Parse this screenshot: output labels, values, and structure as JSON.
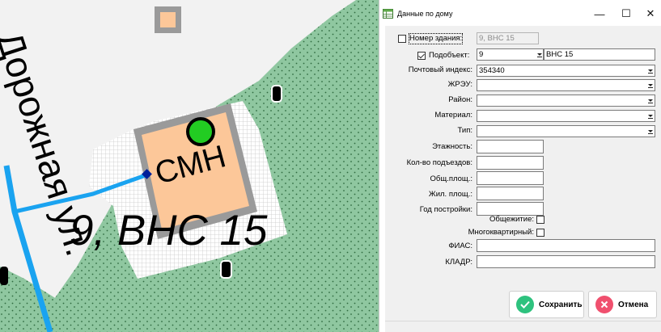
{
  "map": {
    "building_marker": "СМН",
    "address_label": "9, ВНС 15",
    "street_label": "Дорожная ул.",
    "colors": {
      "greenspace": "#8fc7a0",
      "building": "#fcc799",
      "road": "#1aa3f0",
      "hatch": "#cfcfcf",
      "marker_green": "#22cc22",
      "point": "#00209a"
    }
  },
  "dialog": {
    "title": "Данные по дому",
    "title_icon": "table-icon",
    "window_controls": {
      "minimize": "—",
      "maximize": "☐",
      "close": "✕"
    },
    "fields": {
      "building_number": {
        "label": "Номер здания:",
        "value": "9, ВНС 15",
        "checked": false
      },
      "subobject": {
        "label": "Подобъект:",
        "number": "9",
        "name": "ВНС 15",
        "checked": true
      },
      "postal_index": {
        "label": "Почтовый индекс:",
        "value": "354340"
      },
      "zhreu": {
        "label": "ЖРЭУ:",
        "value": ""
      },
      "district": {
        "label": "Район:",
        "value": ""
      },
      "material": {
        "label": "Материал:",
        "value": ""
      },
      "type": {
        "label": "Тип:",
        "value": ""
      },
      "floors": {
        "label": "Этажность:",
        "value": ""
      },
      "entrances": {
        "label": "Кол-во подъездов:",
        "value": ""
      },
      "total_area": {
        "label": "Общ.площ.:",
        "value": ""
      },
      "living_area": {
        "label": "Жил. площ.:",
        "value": ""
      },
      "year_built": {
        "label": "Год постройки:",
        "value": ""
      },
      "dormitory": {
        "label": "Общежитие:",
        "checked": false
      },
      "apartment_building": {
        "label": "Многоквартирный:",
        "checked": false
      },
      "fias": {
        "label": "ФИАС:",
        "value": ""
      },
      "kladr": {
        "label": "КЛАДР:",
        "value": ""
      }
    },
    "buttons": {
      "save": {
        "label": "Сохранить",
        "icon": "check-icon",
        "color": "#2ec27e"
      },
      "cancel": {
        "label": "Отмена",
        "icon": "cross-icon",
        "color": "#f0506e"
      }
    }
  }
}
